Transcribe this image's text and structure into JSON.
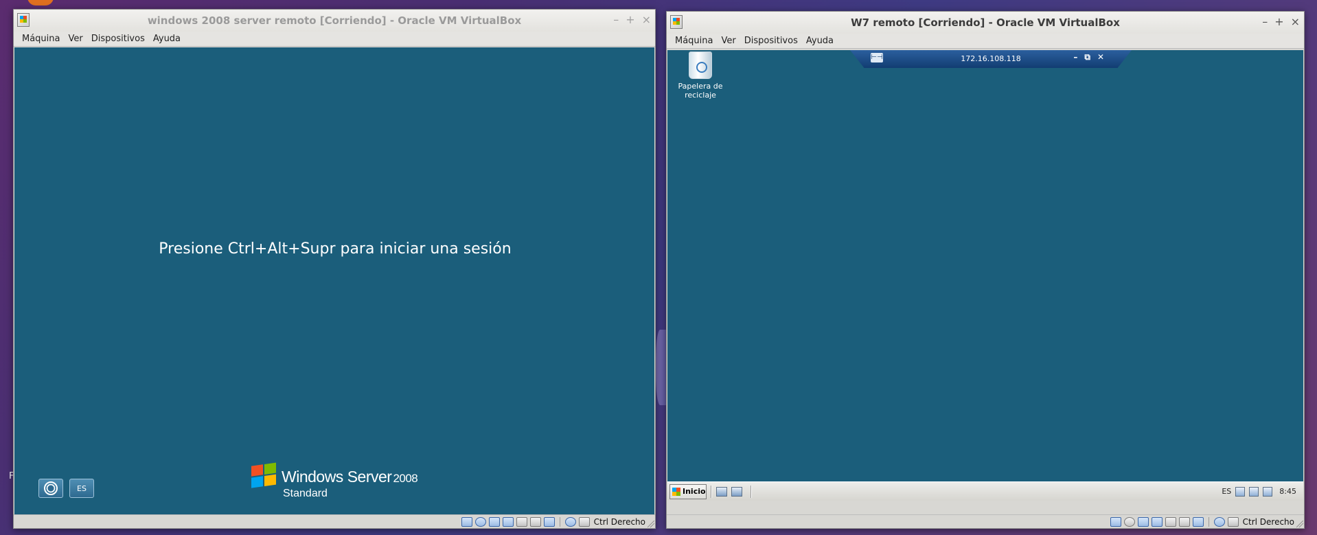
{
  "desktop": {
    "corner_letter": "F"
  },
  "left_window": {
    "title": "windows 2008 server remoto [Corriendo] - Oracle VM VirtualBox",
    "controls": [
      "–",
      "+",
      "×"
    ],
    "menu": [
      "Máquina",
      "Ver",
      "Dispositivos",
      "Ayuda"
    ],
    "screen": {
      "login_prompt": "Presione Ctrl+Alt+Supr para iniciar una sesión",
      "lang_button": "ES",
      "brand_name": "Windows Server",
      "brand_year": "2008",
      "brand_edition": "Standard"
    },
    "status": {
      "host_key": "Ctrl Derecho"
    }
  },
  "right_window": {
    "title": "W7 remoto [Corriendo] - Oracle VM VirtualBox",
    "controls": [
      "–",
      "+",
      "×"
    ],
    "menu": [
      "Máquina",
      "Ver",
      "Dispositivos",
      "Ayuda"
    ],
    "screen": {
      "recycle_bin_label": "Papelera de reciclaje",
      "rdp_host": "172.16.108.118",
      "rdp_pin": "⊢⊣",
      "rdp_controls": [
        "–",
        "⧉",
        "✕"
      ],
      "start_button": "Inicio",
      "tray_lang": "ES",
      "tray_clock": "8:45"
    },
    "status": {
      "host_key": "Ctrl Derecho"
    }
  }
}
